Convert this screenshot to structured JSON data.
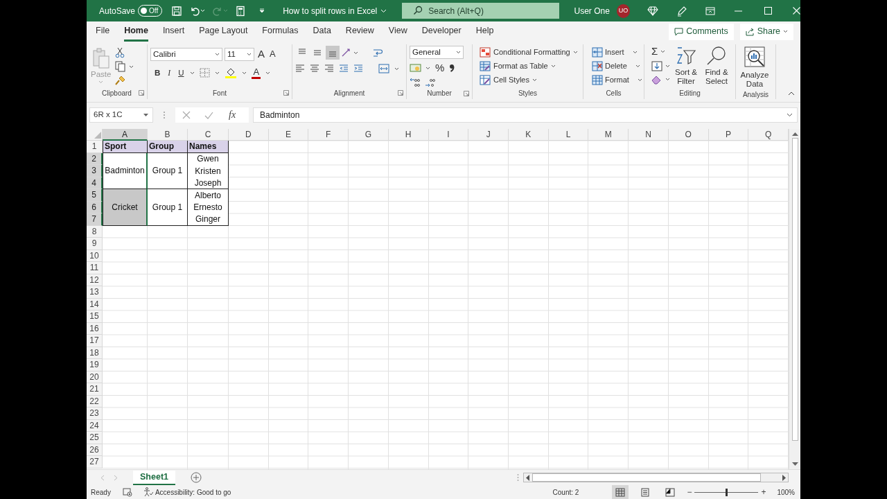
{
  "title_bar": {
    "autosave": {
      "label": "AutoSave",
      "on": false,
      "state_text": "Off"
    },
    "quick_access": [
      {
        "kind": "save",
        "disabled": false
      },
      {
        "kind": "undo",
        "disabled": false
      },
      {
        "kind": "redo",
        "disabled": true
      },
      {
        "kind": "calculator",
        "disabled": false
      }
    ],
    "doc_title": "How to split rows in Excel",
    "search_placeholder": "Search (Alt+Q)",
    "user_name": "User One",
    "avatar_initials": "UO"
  },
  "ribbon_tabs": [
    {
      "label": "File",
      "selected": false
    },
    {
      "label": "Home",
      "selected": true
    },
    {
      "label": "Insert",
      "selected": false
    },
    {
      "label": "Page Layout",
      "selected": false
    },
    {
      "label": "Formulas",
      "selected": false
    },
    {
      "label": "Data",
      "selected": false
    },
    {
      "label": "Review",
      "selected": false
    },
    {
      "label": "View",
      "selected": false
    },
    {
      "label": "Developer",
      "selected": false
    },
    {
      "label": "Help",
      "selected": false
    }
  ],
  "comments_button": "Comments",
  "share_button": "Share",
  "ribbon": {
    "clipboard": {
      "paste": "Paste",
      "label": "Clipboard"
    },
    "font": {
      "name": "Calibri",
      "size": "11",
      "grow": "A",
      "shrink": "A",
      "bold": "B",
      "italic": "I",
      "underline": "U",
      "font_color": "A",
      "label": "Font"
    },
    "alignment": {
      "buttons": [
        {
          "kind": "top",
          "on": false
        },
        {
          "kind": "middle",
          "on": false
        },
        {
          "kind": "bottom",
          "on": true
        }
      ],
      "label": "Alignment"
    },
    "number": {
      "format": "General",
      "percent": "%",
      "label": "Number"
    },
    "styles": {
      "items": [
        "Conditional Formatting",
        "Format as Table",
        "Cell Styles"
      ],
      "label": "Styles"
    },
    "cells": {
      "items": [
        "Insert",
        "Delete",
        "Format"
      ],
      "label": "Cells"
    },
    "editing": {
      "sum": "Σ",
      "sort": "Sort & Filter",
      "find": "Find & Select",
      "label": "Editing"
    },
    "analysis": {
      "button": "Analyze Data",
      "label": "Analysis"
    }
  },
  "name_box": "6R x 1C",
  "fx": "fx",
  "formula": "Badminton",
  "columns": [
    {
      "label": "A",
      "selected": true
    },
    {
      "label": "B",
      "selected": false
    },
    {
      "label": "C",
      "selected": false
    },
    {
      "label": "D",
      "selected": false
    },
    {
      "label": "E",
      "selected": false
    },
    {
      "label": "F",
      "selected": false
    },
    {
      "label": "G",
      "selected": false
    },
    {
      "label": "H",
      "selected": false
    },
    {
      "label": "I",
      "selected": false
    },
    {
      "label": "J",
      "selected": false
    },
    {
      "label": "K",
      "selected": false
    },
    {
      "label": "L",
      "selected": false
    },
    {
      "label": "M",
      "selected": false
    },
    {
      "label": "N",
      "selected": false
    },
    {
      "label": "O",
      "selected": false
    },
    {
      "label": "P",
      "selected": false
    },
    {
      "label": "Q",
      "selected": false
    }
  ],
  "rows": [
    {
      "label": "1",
      "selected": false
    },
    {
      "label": "2",
      "selected": true
    },
    {
      "label": "3",
      "selected": true
    },
    {
      "label": "4",
      "selected": true
    },
    {
      "label": "5",
      "selected": true
    },
    {
      "label": "6",
      "selected": true
    },
    {
      "label": "7",
      "selected": true
    },
    {
      "label": "8",
      "selected": false
    },
    {
      "label": "9",
      "selected": false
    },
    {
      "label": "10",
      "selected": false
    },
    {
      "label": "11",
      "selected": false
    },
    {
      "label": "12",
      "selected": false
    },
    {
      "label": "13",
      "selected": false
    },
    {
      "label": "14",
      "selected": false
    },
    {
      "label": "15",
      "selected": false
    },
    {
      "label": "16",
      "selected": false
    },
    {
      "label": "17",
      "selected": false
    },
    {
      "label": "18",
      "selected": false
    },
    {
      "label": "19",
      "selected": false
    },
    {
      "label": "20",
      "selected": false
    },
    {
      "label": "21",
      "selected": false
    },
    {
      "label": "22",
      "selected": false
    },
    {
      "label": "23",
      "selected": false
    },
    {
      "label": "24",
      "selected": false
    },
    {
      "label": "25",
      "selected": false
    },
    {
      "label": "26",
      "selected": false
    },
    {
      "label": "27",
      "selected": false
    }
  ],
  "table": {
    "header": [
      "Sport",
      "Group",
      "Names"
    ],
    "groups": [
      {
        "sport": "Badminton",
        "group": "Group 1",
        "names": [
          "Gwen",
          "Kristen",
          "Joseph"
        ],
        "selected": true,
        "active": true
      },
      {
        "sport": "Cricket",
        "group": "Group 1",
        "names": [
          "Alberto",
          "Ernesto",
          "Ginger"
        ],
        "selected": true,
        "active": false
      }
    ]
  },
  "sheet_tabs": [
    {
      "label": "Sheet1",
      "selected": true
    }
  ],
  "status_bar": {
    "ready": "Ready",
    "accessibility": "Accessibility: Good to go",
    "count": "Count: 2",
    "views": [
      {
        "kind": "normal",
        "selected": true
      },
      {
        "kind": "page_layout",
        "selected": false
      },
      {
        "kind": "page_break",
        "selected": false
      }
    ],
    "zoom": {
      "minus": "−",
      "plus": "+",
      "level": 0.5,
      "reading": "100%"
    }
  }
}
